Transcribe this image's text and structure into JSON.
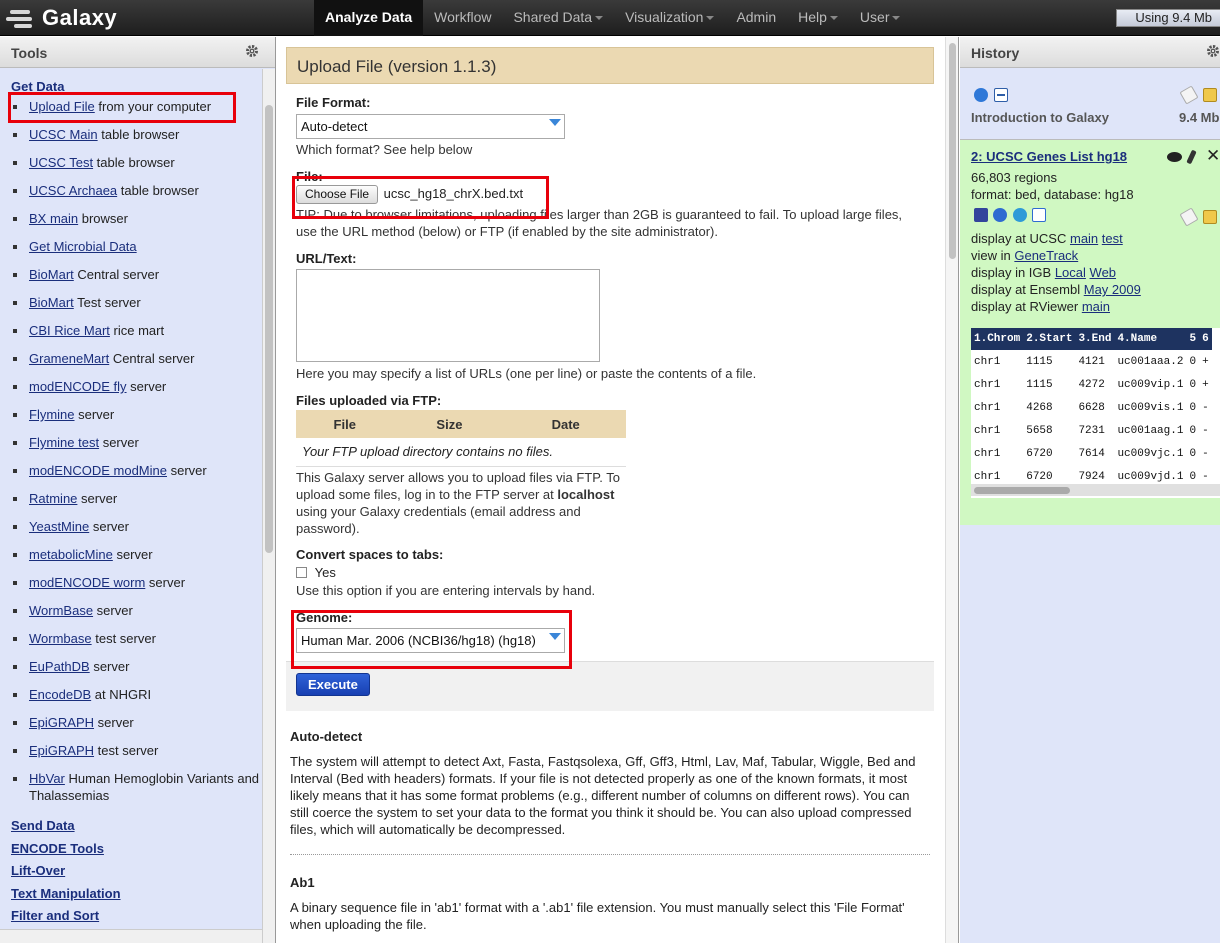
{
  "masthead": {
    "brand": "Galaxy",
    "nav": [
      {
        "label": "Analyze Data",
        "active": true,
        "dropdown": false
      },
      {
        "label": "Workflow",
        "active": false,
        "dropdown": false
      },
      {
        "label": "Shared Data",
        "active": false,
        "dropdown": true
      },
      {
        "label": "Visualization",
        "active": false,
        "dropdown": true
      },
      {
        "label": "Admin",
        "active": false,
        "dropdown": false
      },
      {
        "label": "Help",
        "active": false,
        "dropdown": true
      },
      {
        "label": "User",
        "active": false,
        "dropdown": true
      }
    ],
    "quota": "Using 9.4 Mb"
  },
  "tools": {
    "header": "Tools",
    "get_data_title": "Get Data",
    "get_data_items": [
      {
        "link": "Upload File",
        "rest": " from your computer"
      },
      {
        "link": "UCSC Main",
        "rest": " table browser"
      },
      {
        "link": "UCSC Test",
        "rest": " table browser"
      },
      {
        "link": "UCSC Archaea",
        "rest": " table browser"
      },
      {
        "link": "BX main",
        "rest": " browser"
      },
      {
        "link": "Get Microbial Data",
        "rest": ""
      },
      {
        "link": "BioMart",
        "rest": " Central server"
      },
      {
        "link": "BioMart",
        "rest": " Test server"
      },
      {
        "link": "CBI Rice Mart",
        "rest": " rice mart"
      },
      {
        "link": "GrameneMart",
        "rest": " Central server"
      },
      {
        "link": "modENCODE fly",
        "rest": " server"
      },
      {
        "link": "Flymine",
        "rest": " server"
      },
      {
        "link": "Flymine test",
        "rest": " server"
      },
      {
        "link": "modENCODE modMine",
        "rest": " server"
      },
      {
        "link": "Ratmine",
        "rest": " server"
      },
      {
        "link": "YeastMine",
        "rest": " server"
      },
      {
        "link": "metabolicMine",
        "rest": " server"
      },
      {
        "link": "modENCODE worm",
        "rest": " server"
      },
      {
        "link": "WormBase",
        "rest": " server"
      },
      {
        "link": "Wormbase",
        "rest": " test server"
      },
      {
        "link": "EuPathDB",
        "rest": " server"
      },
      {
        "link": "EncodeDB",
        "rest": " at NHGRI"
      },
      {
        "link": "EpiGRAPH",
        "rest": " server"
      },
      {
        "link": "EpiGRAPH",
        "rest": " test server"
      },
      {
        "link": "HbVar",
        "rest": " Human Hemoglobin Variants and Thalassemias"
      }
    ],
    "other_sections": [
      "Send Data",
      "ENCODE Tools",
      "Lift-Over",
      "Text Manipulation",
      "Filter and Sort"
    ]
  },
  "form": {
    "title": "Upload File (version 1.1.3)",
    "file_format_label": "File Format:",
    "file_format_value": "Auto-detect",
    "file_format_help": "Which format? See help below",
    "file_label": "File:",
    "choose_file": "Choose File",
    "file_name": "ucsc_hg18_chrX.bed.txt",
    "file_help": "TIP: Due to browser limitations, uploading files larger than 2GB is guaranteed to fail. To upload large files, use the URL method (below) or FTP (if enabled by the site administrator).",
    "url_label": "URL/Text:",
    "url_value": "",
    "url_help": "Here you may specify a list of URLs (one per line) or paste the contents of a file.",
    "ftp_label": "Files uploaded via FTP:",
    "ftp_columns": [
      "File",
      "Size",
      "Date"
    ],
    "ftp_empty": "Your FTP upload directory contains no files.",
    "ftp_help_1": "This Galaxy server allows you to upload files via FTP. To upload some files, log in to the FTP server at ",
    "ftp_host": "localhost",
    "ftp_help_2": " using your Galaxy credentials (email address and password).",
    "spaces_label": "Convert spaces to tabs:",
    "spaces_option": "Yes",
    "spaces_help": "Use this option if you are entering intervals by hand.",
    "genome_label": "Genome:",
    "genome_value": "Human Mar. 2006 (NCBI36/hg18) (hg18)",
    "execute": "Execute"
  },
  "help": {
    "autodetect_title": "Auto-detect",
    "autodetect_text": "The system will attempt to detect Axt, Fasta, Fastqsolexa, Gff, Gff3, Html, Lav, Maf, Tabular, Wiggle, Bed and Interval (Bed with headers) formats. If your file is not detected properly as one of the known formats, it most likely means that it has some format problems (e.g., different number of columns on different rows). You can still coerce the system to set your data to the format you think it should be. You can also upload compressed files, which will automatically be decompressed.",
    "ab1_title": "Ab1",
    "ab1_text": "A binary sequence file in 'ab1' format with a '.ab1' file extension. You must manually select this 'File Format' when uploading the file."
  },
  "history": {
    "header": "History",
    "name": "Introduction to Galaxy",
    "size": "9.4 Mb",
    "dataset": {
      "title": "2: UCSC Genes List hg18",
      "regions": "66,803 regions",
      "format": "format: bed, database: hg18",
      "display_ucsc": {
        "prefix": "display at UCSC ",
        "links": [
          "main",
          "test"
        ]
      },
      "view_in": {
        "prefix": "view in ",
        "links": [
          "GeneTrack"
        ]
      },
      "display_igb": {
        "prefix": "display in IGB ",
        "links": [
          "Local",
          "Web"
        ]
      },
      "display_ensembl": {
        "prefix": "display at Ensembl ",
        "links": [
          "May 2009"
        ]
      },
      "display_rviewer": {
        "prefix": "display at RViewer ",
        "links": [
          "main"
        ]
      },
      "peek_columns": [
        "1.Chrom",
        "2.Start",
        "3.End",
        "4.Name",
        "5",
        "6"
      ],
      "peek_rows": [
        [
          "chr1",
          "1115",
          "4121",
          "uc001aaa.2",
          "0",
          "+"
        ],
        [
          "chr1",
          "1115",
          "4272",
          "uc009vip.1",
          "0",
          "+"
        ],
        [
          "chr1",
          "4268",
          "6628",
          "uc009vis.1",
          "0",
          "-"
        ],
        [
          "chr1",
          "5658",
          "7231",
          "uc001aag.1",
          "0",
          "-"
        ],
        [
          "chr1",
          "6720",
          "7614",
          "uc009vjc.1",
          "0",
          "-"
        ],
        [
          "chr1",
          "6720",
          "7924",
          "uc009vjd.1",
          "0",
          "-"
        ]
      ]
    }
  }
}
